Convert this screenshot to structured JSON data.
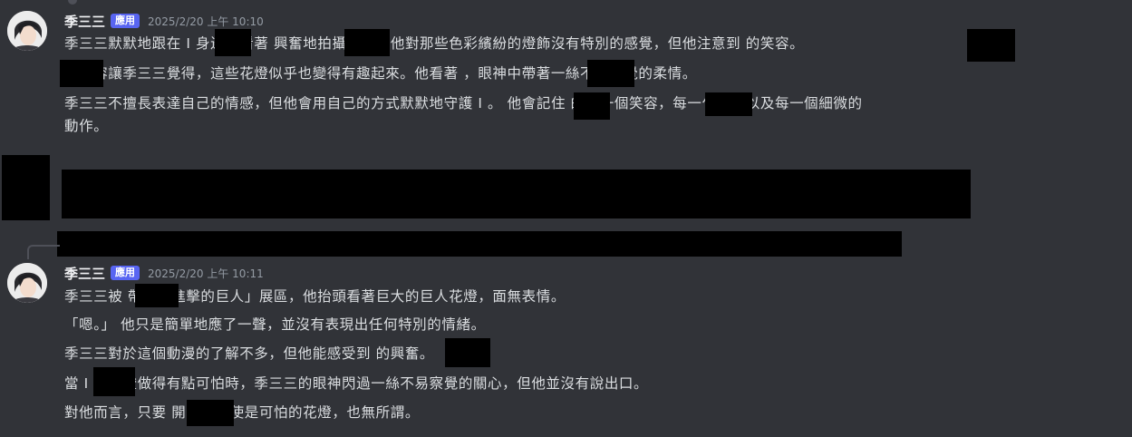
{
  "messages": [
    {
      "username": "季三三",
      "badge": "應用",
      "timestamp": "2025/2/20 上午 10:10",
      "lines": [
        "季三三默默地跟在 I 身邊，看著 興奮地拍攝花燈。他對那些色彩繽紛的燈飾沒有特別的感覺，但他注意到 的笑容。",
        " 的笑容讓季三三覺得，這些花燈似乎也變得有趣起來。他看著 ，眼神中帶著一絲不易察覺的柔情。",
        "季三三不擅長表達自己的情感，但他會用自己的方式默默地守護 I 。 他會記住 的每一個笑容，每一句話，以及每一個細微的",
        "動作。"
      ]
    },
    {
      "username": "季三三",
      "badge": "應用",
      "timestamp": "2025/2/20 上午 10:11",
      "lines": [
        "季三三被 帶到「進擊的巨人」展區，他抬頭看著巨大的巨人花燈，面無表情。",
        "「嗯。」 他只是簡單地應了一聲，並沒有表現出任何特別的情緒。",
        "季三三對於這個動漫的了解不多，但他能感受到 的興奮。",
        "當 I 說花燈做得有點可怕時，季三三的眼神閃過一絲不易察覺的關心，但他並沒有說出口。",
        "對他而言，只要 開心，即使是可怕的花燈，也無所謂。"
      ]
    }
  ],
  "colors": {
    "background": "#313338",
    "text": "#dbdee1",
    "badge": "#5865f2",
    "timestamp": "#949ba4",
    "redaction": "#000000"
  }
}
